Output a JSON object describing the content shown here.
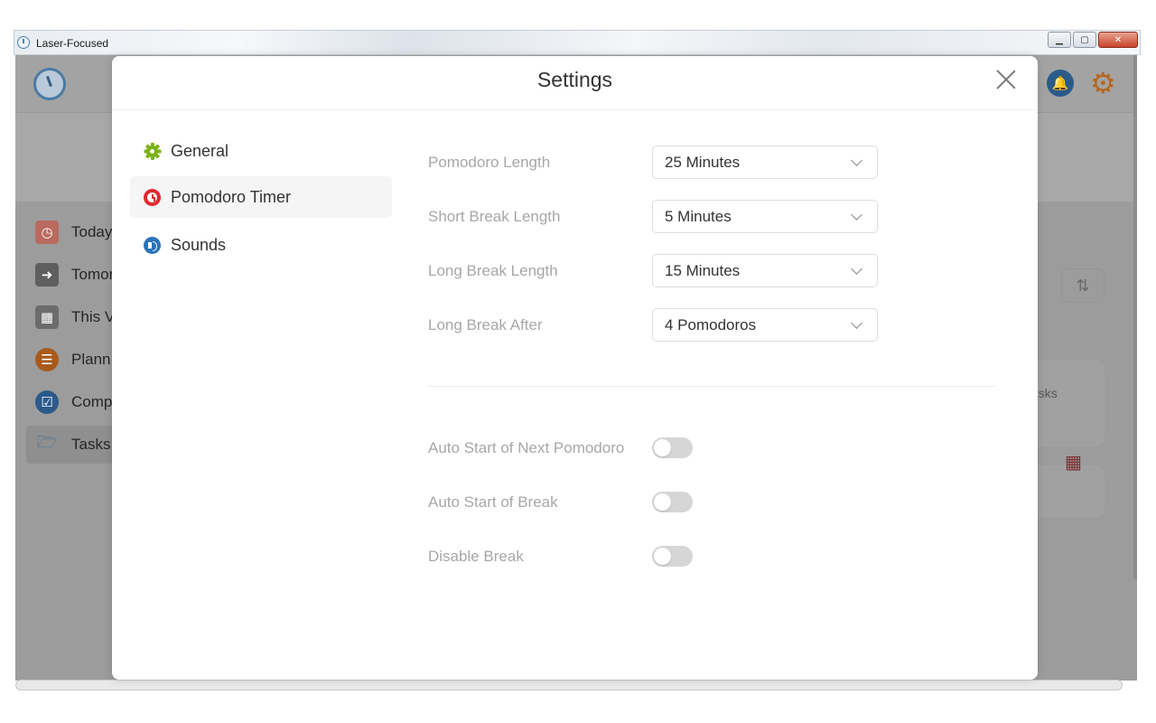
{
  "window": {
    "title": "Laser-Focused",
    "minimize_glyph": "▁",
    "maximize_glyph": "▢",
    "close_glyph": "✕"
  },
  "background_app": {
    "sidebar_items": [
      {
        "label": "Today",
        "icon": "calendar-clock-icon"
      },
      {
        "label": "Tomor",
        "icon": "calendar-arrow-icon"
      },
      {
        "label": "This V",
        "icon": "calendar-week-icon"
      },
      {
        "label": "Plann",
        "icon": "clipboard-icon"
      },
      {
        "label": "Comp",
        "icon": "checkbox-icon"
      },
      {
        "label": "Tasks",
        "icon": "folder-icon"
      }
    ],
    "sort_glyph": "⇅",
    "right_text": "asks"
  },
  "settings": {
    "title": "Settings",
    "nav": [
      {
        "label": "General",
        "icon": "gear-icon"
      },
      {
        "label": "Pomodoro Timer",
        "icon": "tomato-icon"
      },
      {
        "label": "Sounds",
        "icon": "sound-icon"
      }
    ],
    "selects": [
      {
        "label": "Pomodoro Length",
        "value": "25 Minutes"
      },
      {
        "label": "Short Break Length",
        "value": "5 Minutes"
      },
      {
        "label": "Long Break Length",
        "value": "15 Minutes"
      },
      {
        "label": "Long Break After",
        "value": "4 Pomodoros"
      }
    ],
    "toggles": [
      {
        "label": "Auto Start of Next Pomodoro",
        "on": false
      },
      {
        "label": "Auto Start of Break",
        "on": false
      },
      {
        "label": "Disable Break",
        "on": false
      }
    ]
  },
  "colors": {
    "accent_green": "#7ab317",
    "tomato_red": "#e0282e",
    "sound_blue": "#2b74b9",
    "label_gray": "#a7a7a7",
    "toggle_off": "#d6d6d6"
  }
}
